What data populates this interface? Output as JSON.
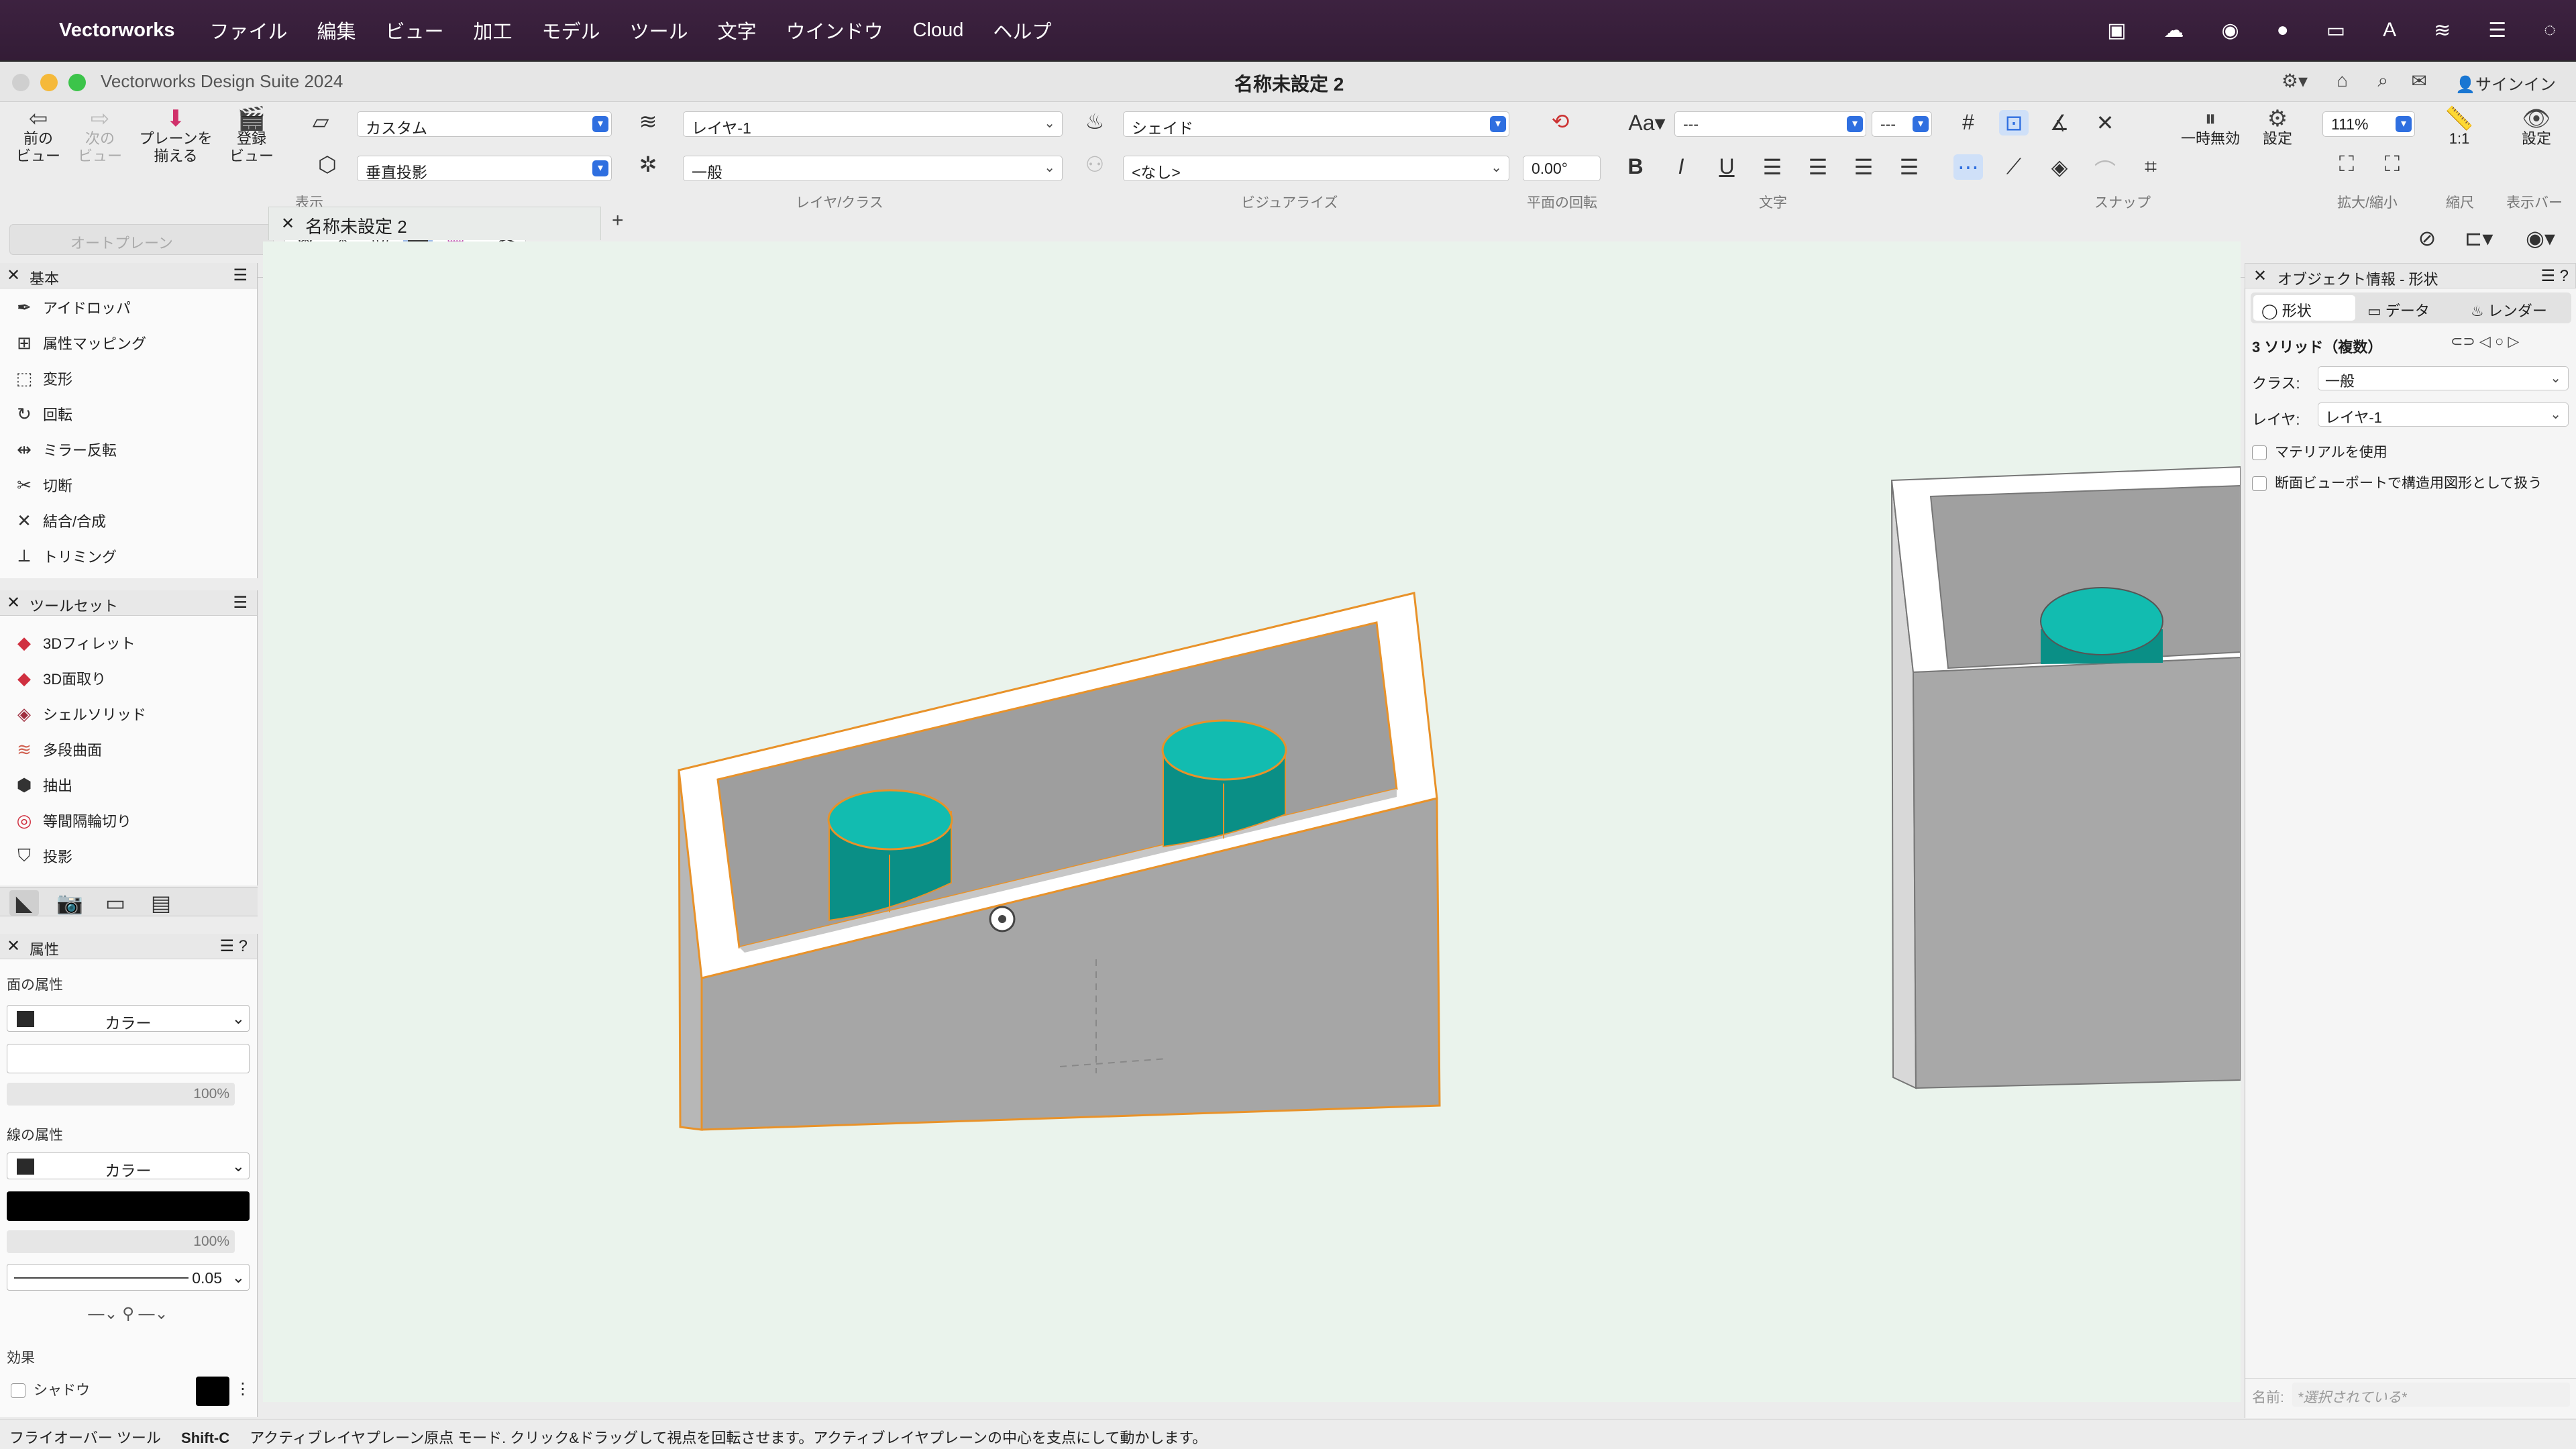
{
  "menubar": {
    "app": "Vectorworks",
    "items": [
      "ファイル",
      "編集",
      "ビュー",
      "加工",
      "モデル",
      "ツール",
      "文字",
      "ウインドウ",
      "Cloud",
      "ヘルプ"
    ]
  },
  "window": {
    "app_title": "Vectorworks Design Suite 2024",
    "doc_title": "名称未設定 2",
    "signin": "サインイン"
  },
  "toolbar": {
    "prev_view": "前の\nビュー",
    "next_view": "次の\nビュー",
    "align_plane": "プレーンを\n揃える",
    "saved_view": "登録\nビュー",
    "view_select": "カスタム",
    "projection_select": "垂直投影",
    "view_group_label": "表示",
    "layer_select": "レイヤ-1",
    "class_select": "一般",
    "layer_class_label": "レイヤ/クラス",
    "render_select": "シェイド",
    "none_select": "<なし>",
    "visualize_label": "ビジュアライズ",
    "plane_rotation_value": "0.00°",
    "plane_rotation_label": "平面の回転",
    "font_select": "---",
    "size_select": "---",
    "text_label": "文字",
    "snap_label": "スナップ",
    "pause_label": "一時無効",
    "settings_label": "設定",
    "zoom_value": "111%",
    "zoom_label": "拡大/縮小",
    "scale_value": "1:1",
    "scale_label": "縮尺",
    "display_bar_label": "表示バー",
    "display_settings": "設定",
    "auto_plane": "オートプレーン"
  },
  "basic_palette": {
    "title": "基本",
    "items": [
      "アイドロッパ",
      "属性マッピング",
      "変形",
      "回転",
      "ミラー反転",
      "切断",
      "結合/合成",
      "トリミング"
    ]
  },
  "toolset_palette": {
    "title": "ツールセット",
    "items": [
      "3Dフィレット",
      "3D面取り",
      "シェルソリッド",
      "多段曲面",
      "抽出",
      "等間隔輪切り",
      "投影"
    ]
  },
  "attributes": {
    "title": "属性",
    "fill_label": "面の属性",
    "fill_type": "カラー",
    "fill_opacity": "100%",
    "line_label": "線の属性",
    "line_type": "カラー",
    "line_opacity": "100%",
    "line_weight": "0.05",
    "effects_label": "効果",
    "shadow_label": "シャドウ"
  },
  "doc_tab": {
    "label": "名称未設定 2"
  },
  "oip": {
    "title": "オブジェクト情報 - 形状",
    "tabs": [
      "形状",
      "データ",
      "レンダー"
    ],
    "object_type": "3 ソリッド（複数）",
    "class_label": "クラス:",
    "class_value": "一般",
    "layer_label": "レイヤ:",
    "layer_value": "レイヤ-1",
    "use_material": "マテリアルを使用",
    "section_viewport": "断面ビューポートで構造用図形として扱う",
    "name_label": "名前:",
    "name_placeholder": "*選択されている*"
  },
  "statusbar": {
    "tool": "フライオーバー ツール",
    "shortcut": "Shift-C",
    "hint": "アクティブレイヤプレーン原点 モード. クリック&ドラッグして視点を回転させます。アクティブレイヤプレーンの中心を支点にして動かします。"
  },
  "colors": {
    "menubar": "#3d2240",
    "viewport_bg": "#eaf3ec",
    "solid_gray": "#a8a8a8",
    "cylinder": "#12bcb0",
    "selection": "#e8922a",
    "accent": "#2f6fe0"
  }
}
